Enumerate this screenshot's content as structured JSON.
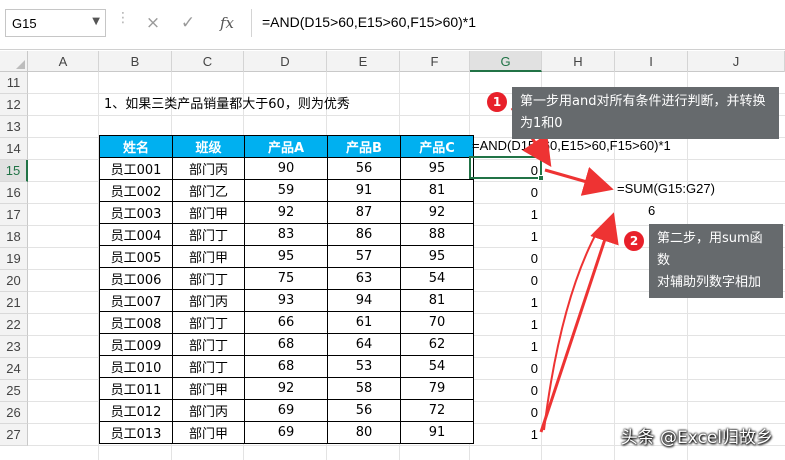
{
  "formula_bar": {
    "name_box": "G15",
    "cancel_icon": "×",
    "enter_icon": "✓",
    "fx_label": "fx",
    "formula": "=AND(D15>60,E15>60,F15>60)*1"
  },
  "columns": [
    "A",
    "B",
    "C",
    "D",
    "E",
    "F",
    "G",
    "H",
    "I",
    "J"
  ],
  "selected_column": "G",
  "rows": [
    "11",
    "12",
    "13",
    "14",
    "15",
    "16",
    "17",
    "18",
    "19",
    "20",
    "21",
    "22",
    "23",
    "24",
    "25",
    "26",
    "27"
  ],
  "selected_row": "15",
  "sheet": {
    "instruction": "1、如果三类产品销量都大于60，则为优秀",
    "g14_formula_text": "=AND(D15>60,E15>60,F15>60)*1",
    "sum_formula_text": "=SUM(G15:G27)",
    "sum_result": "6"
  },
  "table": {
    "headers": [
      "姓名",
      "班级",
      "产品A",
      "产品B",
      "产品C"
    ],
    "rows": [
      [
        "员工001",
        "部门丙",
        "90",
        "56",
        "95"
      ],
      [
        "员工002",
        "部门乙",
        "59",
        "91",
        "81"
      ],
      [
        "员工003",
        "部门甲",
        "92",
        "87",
        "92"
      ],
      [
        "员工004",
        "部门丁",
        "83",
        "86",
        "88"
      ],
      [
        "员工005",
        "部门甲",
        "95",
        "57",
        "95"
      ],
      [
        "员工006",
        "部门丁",
        "75",
        "63",
        "54"
      ],
      [
        "员工007",
        "部门丙",
        "93",
        "94",
        "81"
      ],
      [
        "员工008",
        "部门丁",
        "66",
        "61",
        "70"
      ],
      [
        "员工009",
        "部门丁",
        "68",
        "64",
        "62"
      ],
      [
        "员工010",
        "部门丁",
        "68",
        "53",
        "54"
      ],
      [
        "员工011",
        "部门甲",
        "92",
        "58",
        "79"
      ],
      [
        "员工012",
        "部门丙",
        "69",
        "56",
        "72"
      ],
      [
        "员工013",
        "部门甲",
        "69",
        "80",
        "91"
      ]
    ]
  },
  "helper_values": [
    "0",
    "0",
    "1",
    "1",
    "0",
    "0",
    "1",
    "1",
    "1",
    "0",
    "0",
    "0",
    "1"
  ],
  "callouts": [
    {
      "badge": "1",
      "text_line1": "第一步用and对所有条件进行判断，并转换",
      "text_line2": "为1和0"
    },
    {
      "badge": "2",
      "text_line1": "第二步，用sum函数",
      "text_line2": "对辅助列数字相加"
    }
  ],
  "watermark": "头条 @Excel归故乡",
  "colors": {
    "header_bg": "#00b0f0",
    "selection": "#217346",
    "callout_bg": "#666a6d",
    "badge": "#e8202a",
    "arrow": "#ee3333"
  }
}
